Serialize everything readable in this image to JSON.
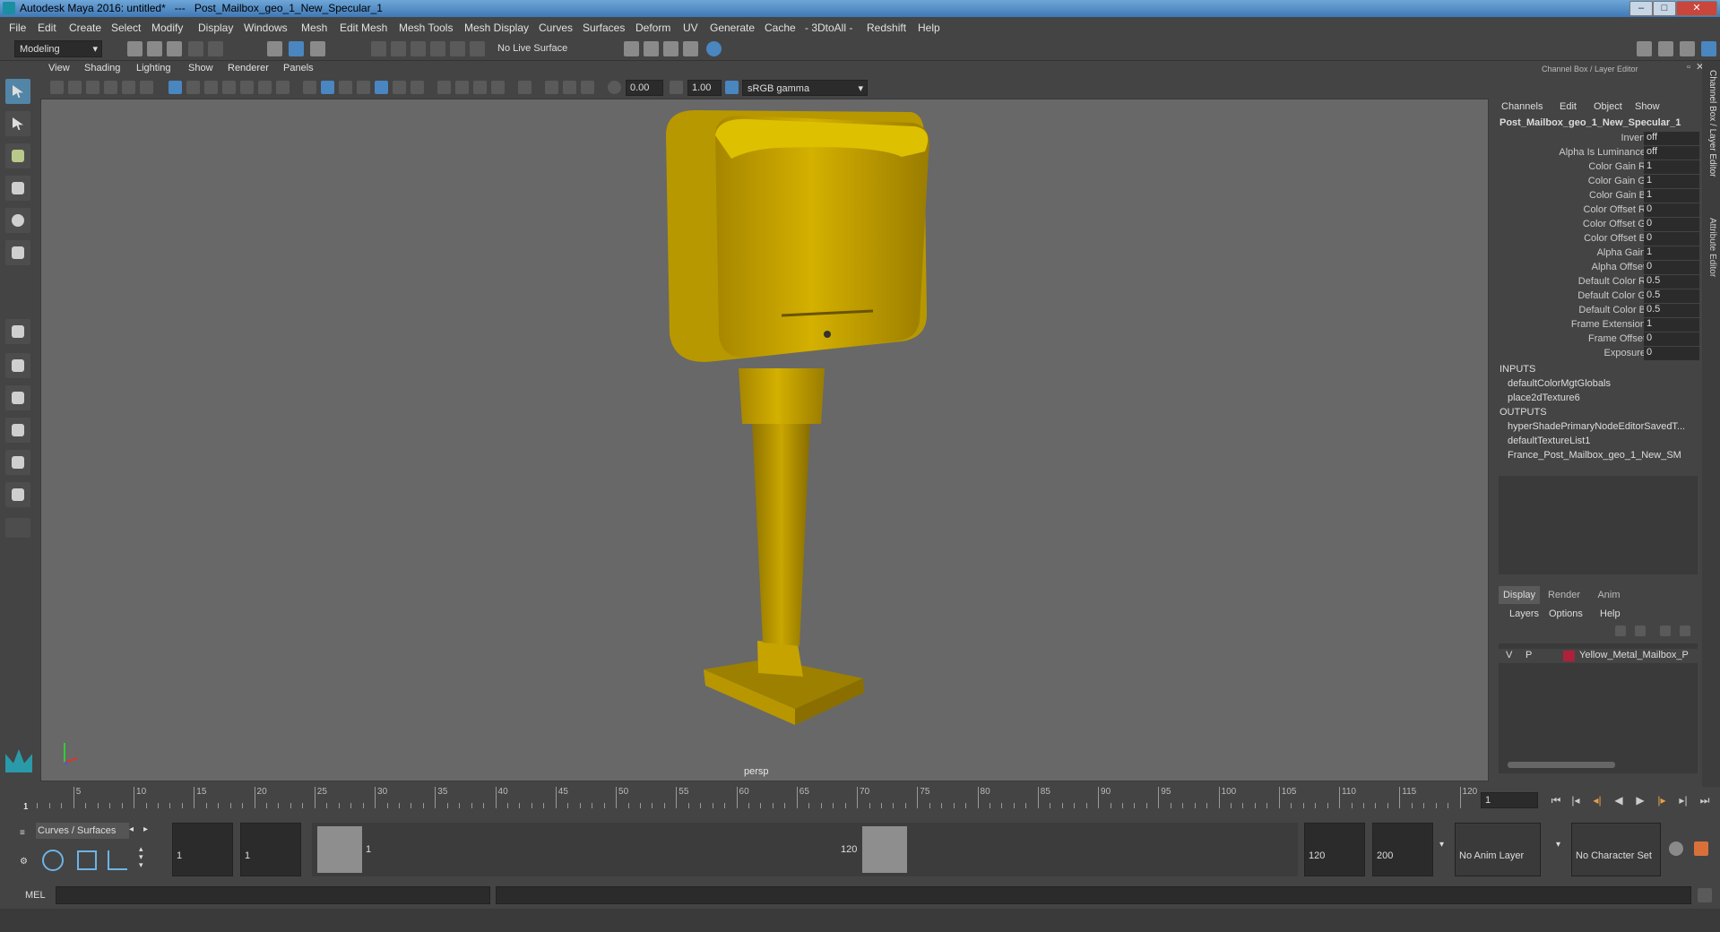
{
  "window": {
    "app_title": "Autodesk Maya 2016: untitled*",
    "separator": "---",
    "object_title": "Post_Mailbox_geo_1_New_Specular_1",
    "buttons": [
      "–",
      "□",
      "✕"
    ]
  },
  "menubar": [
    "File",
    "Edit",
    "Create",
    "Select",
    "Modify",
    "Display",
    "Windows",
    "Mesh",
    "Edit Mesh",
    "Mesh Tools",
    "Mesh Display",
    "Curves",
    "Surfaces",
    "Deform",
    "UV",
    "Generate",
    "Cache",
    "- 3DtoAll -",
    "Redshift",
    "Help"
  ],
  "shelf": {
    "mode": "Modeling",
    "live_surface": "No Live Surface"
  },
  "viewport": {
    "menu": [
      "View",
      "Shading",
      "Lighting",
      "Show",
      "Renderer",
      "Panels"
    ],
    "exposure": "0.00",
    "gamma": "1.00",
    "color_space": "sRGB gamma",
    "camera": "persp"
  },
  "channel_box": {
    "header": "Channel Box / Layer Editor",
    "menu": [
      "Channels",
      "Edit",
      "Object",
      "Show"
    ],
    "object": "Post_Mailbox_geo_1_New_Specular_1",
    "attributes": [
      {
        "name": "Invert",
        "value": "off"
      },
      {
        "name": "Alpha Is Luminance",
        "value": "off"
      },
      {
        "name": "Color Gain R",
        "value": "1"
      },
      {
        "name": "Color Gain G",
        "value": "1"
      },
      {
        "name": "Color Gain B",
        "value": "1"
      },
      {
        "name": "Color Offset R",
        "value": "0"
      },
      {
        "name": "Color Offset G",
        "value": "0"
      },
      {
        "name": "Color Offset B",
        "value": "0"
      },
      {
        "name": "Alpha Gain",
        "value": "1"
      },
      {
        "name": "Alpha Offset",
        "value": "0"
      },
      {
        "name": "Default Color R",
        "value": "0.5"
      },
      {
        "name": "Default Color G",
        "value": "0.5"
      },
      {
        "name": "Default Color B",
        "value": "0.5"
      },
      {
        "name": "Frame Extension",
        "value": "1"
      },
      {
        "name": "Frame Offset",
        "value": "0"
      },
      {
        "name": "Exposure",
        "value": "0"
      }
    ],
    "inputs_label": "INPUTS",
    "inputs": [
      "defaultColorMgtGlobals",
      "place2dTexture6"
    ],
    "outputs_label": "OUTPUTS",
    "outputs": [
      "hyperShadePrimaryNodeEditorSavedT...",
      "defaultTextureList1",
      "France_Post_Mailbox_geo_1_New_SM"
    ]
  },
  "side_tabs": [
    "Channel Box / Layer Editor",
    "Attribute Editor"
  ],
  "layer_editor": {
    "tabs": [
      "Display",
      "Render",
      "Anim"
    ],
    "menu": [
      "Layers",
      "Options",
      "Help"
    ],
    "layer": {
      "v": "V",
      "p": "P",
      "name": "Yellow_Metal_Mailbox_P",
      "color": "#b0203a"
    }
  },
  "timeline": {
    "ticks": [
      "5",
      "10",
      "15",
      "20",
      "25",
      "30",
      "35",
      "40",
      "45",
      "50",
      "55",
      "60",
      "65",
      "70",
      "75",
      "80",
      "85",
      "90",
      "95",
      "100",
      "105",
      "110",
      "115",
      "120"
    ],
    "start_label": "1",
    "current_frame": "1"
  },
  "range": {
    "shelf_tab": "Curves / Surfaces",
    "start": "1",
    "playback_start": "1",
    "slider_start": "1",
    "slider_end": "120",
    "playback_end": "120",
    "end": "200",
    "anim_layer": "No Anim Layer",
    "character_set": "No Character Set"
  },
  "command": {
    "lang": "MEL"
  },
  "colors": {
    "mailbox": "#c8a400",
    "accent": "#5285a6"
  }
}
